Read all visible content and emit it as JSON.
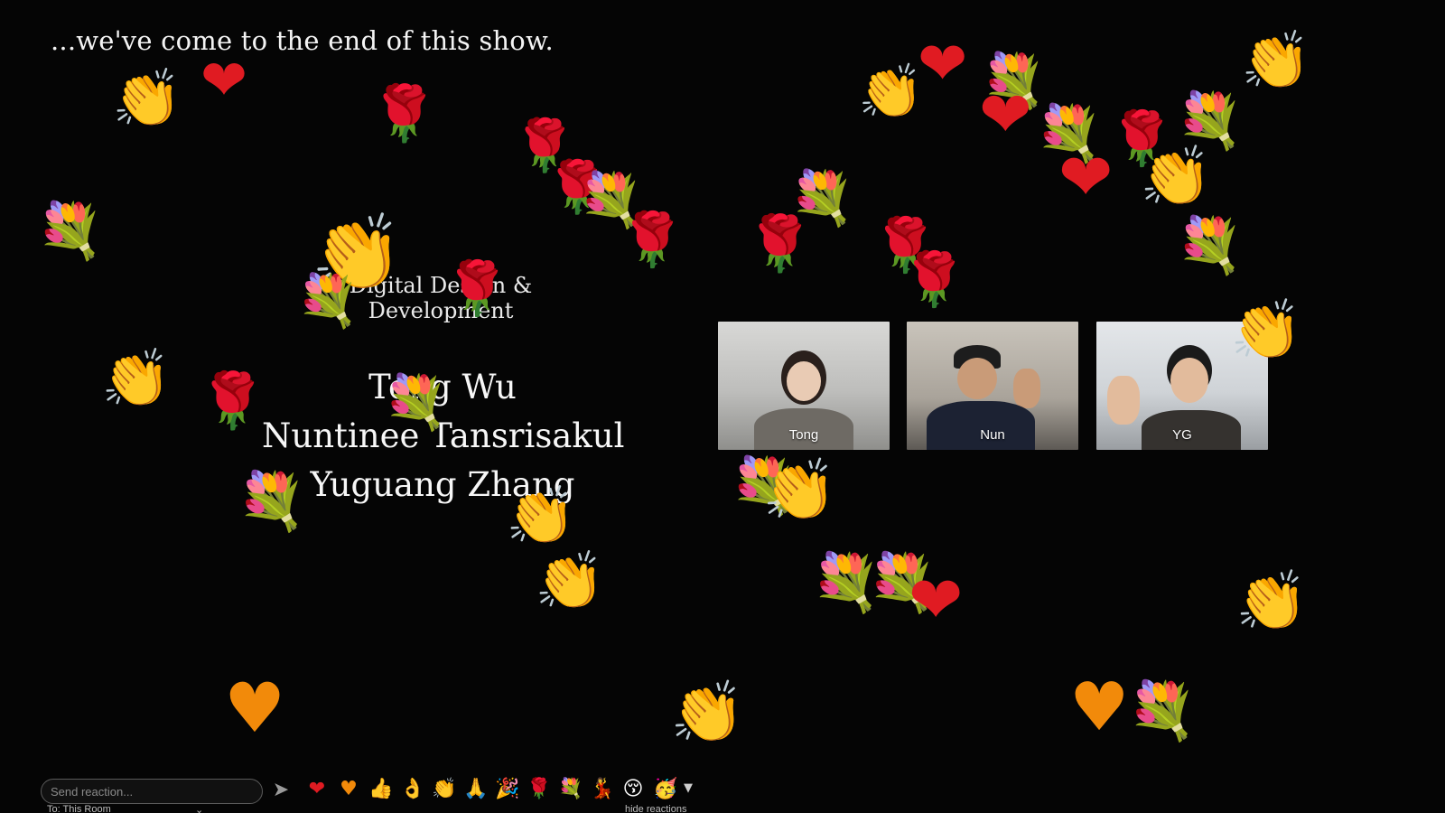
{
  "slide": {
    "headline": "...we've come to the end of this show.",
    "subtitle": "Digital Design & Development",
    "names": [
      "Tong Wu",
      "Nuntinee Tansrisakul",
      "Yuguang Zhang"
    ]
  },
  "participants": [
    {
      "name": "Tong"
    },
    {
      "name": "Nun"
    },
    {
      "name": "YG"
    }
  ],
  "floating_reactions": {
    "heart": "❤",
    "orange_heart": "♥",
    "rose": "🌹",
    "clap": "👏",
    "bouquet": "💐"
  },
  "reaction_bar": {
    "input_placeholder": "Send reaction...",
    "send_icon": "send-icon",
    "quick_reactions": [
      {
        "icon": "red-heart-icon",
        "glyph": "❤"
      },
      {
        "icon": "orange-heart-icon",
        "glyph": "♥"
      },
      {
        "icon": "thumbs-up-icon",
        "glyph": "👍"
      },
      {
        "icon": "ok-hand-icon",
        "glyph": "👌"
      },
      {
        "icon": "clap-icon",
        "glyph": "👏"
      },
      {
        "icon": "pray-icon",
        "glyph": "🙏"
      },
      {
        "icon": "party-popper-icon",
        "glyph": "🎉"
      },
      {
        "icon": "rose-icon",
        "glyph": "🌹"
      },
      {
        "icon": "bouquet-icon",
        "glyph": "💐"
      },
      {
        "icon": "dancer-icon",
        "glyph": "💃"
      },
      {
        "icon": "kissing-face-icon",
        "glyph": "😚"
      },
      {
        "icon": "partying-face-icon",
        "glyph": "🥳"
      }
    ],
    "more_icon": "▼",
    "to_label": "To:",
    "to_value": "This Room",
    "hide_label": "hide reactions"
  },
  "colors": {
    "background": "#050505",
    "heart": "#e01b22",
    "orange_heart": "#f28a0a",
    "clap": "#f7c21b"
  }
}
